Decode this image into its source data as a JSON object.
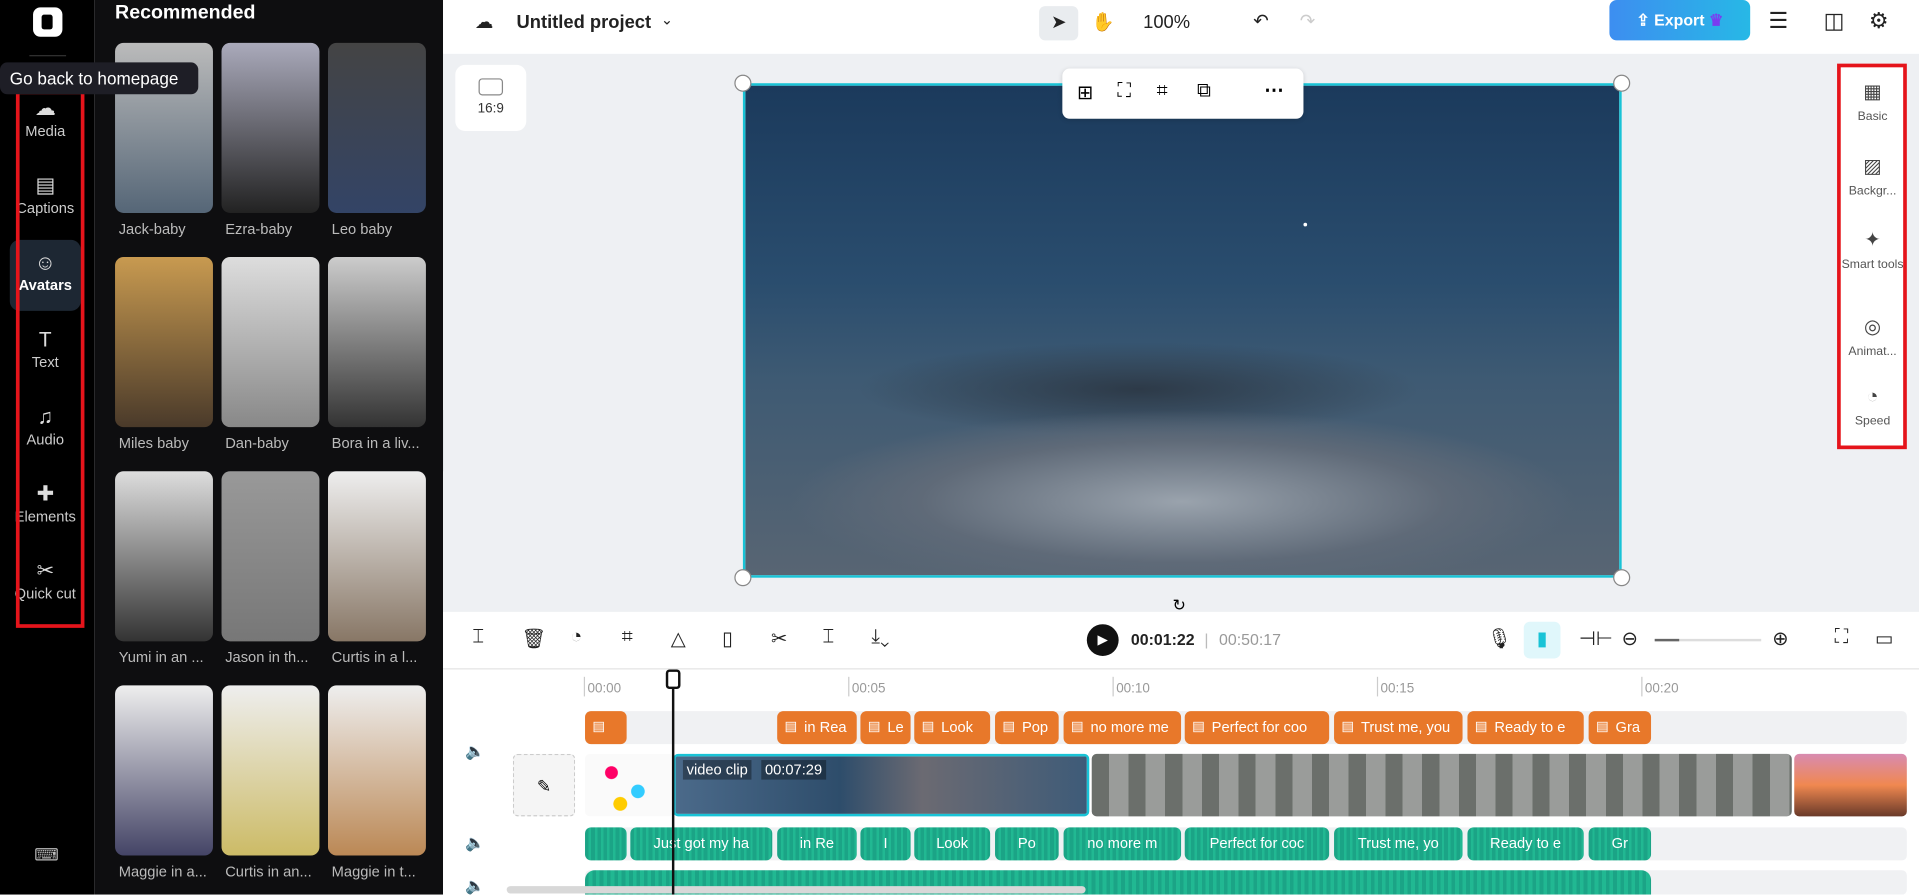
{
  "tooltip": "Go back to homepage",
  "rail": [
    {
      "label": "Media",
      "icon": "cloud-upload-icon"
    },
    {
      "label": "Captions",
      "icon": "captions-icon"
    },
    {
      "label": "Avatars",
      "icon": "avatar-icon",
      "active": true
    },
    {
      "label": "Text",
      "icon": "text-icon"
    },
    {
      "label": "Audio",
      "icon": "music-icon"
    },
    {
      "label": "Elements",
      "icon": "elements-icon"
    },
    {
      "label": "Quick cut",
      "icon": "quick-cut-icon"
    }
  ],
  "panel": {
    "title": "Recommended",
    "avatars": [
      "Jack-baby",
      "Ezra-baby",
      "Leo baby",
      "Miles baby",
      "Dan-baby",
      "Bora in a liv...",
      "Yumi in an ...",
      "Jason in th...",
      "Curtis in a l...",
      "Maggie in a...",
      "Curtis in an...",
      "Maggie in t..."
    ]
  },
  "topbar": {
    "project": "Untitled project",
    "zoom": "100%",
    "export": "Export"
  },
  "canvas": {
    "ratio": "16:9"
  },
  "right_panel": [
    {
      "label": "Basic",
      "icon": "film-icon"
    },
    {
      "label": "Backgr...",
      "icon": "background-icon"
    },
    {
      "label": "Smart tools",
      "icon": "magic-wand-icon"
    },
    {
      "label": "Animat...",
      "icon": "animation-icon"
    },
    {
      "label": "Speed",
      "icon": "speedometer-icon"
    }
  ],
  "playback": {
    "current": "00:01:22",
    "total": "00:50:17"
  },
  "ruler": [
    "00:00",
    "00:05",
    "00:10",
    "00:15",
    "00:20"
  ],
  "video_clip": {
    "label": "video clip",
    "duration": "00:07:29"
  },
  "captions": [
    "",
    "in Rea",
    "Le",
    "Look",
    "Pop",
    "no more me",
    "Perfect for coo",
    "Trust me, you",
    "Ready to e",
    "Gra"
  ],
  "audio": [
    "",
    "Just got my ha",
    "in Re",
    "I",
    "Look",
    "Po",
    "no more m",
    "Perfect for coc",
    "Trust me, yo",
    "Ready to e",
    "Gr"
  ],
  "colors": {
    "accent": "#19c3d6",
    "caption": "#e8782a",
    "audio": "#1ba486",
    "export": "#3d8ef0"
  }
}
